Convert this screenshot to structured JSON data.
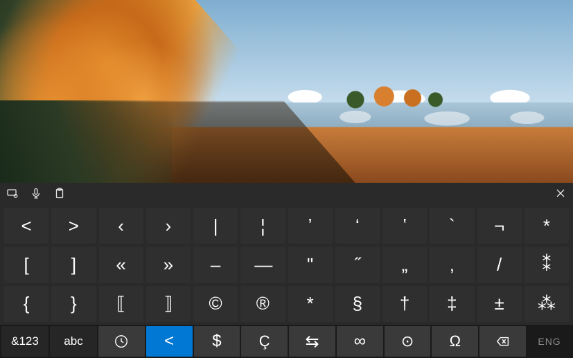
{
  "topbar": {
    "icons": [
      "keyboard-settings-icon",
      "mic-icon",
      "clipboard-icon"
    ],
    "close": "close-icon"
  },
  "rows": [
    [
      "<",
      ">",
      "‹",
      "›",
      "|",
      "¦",
      "ʼ",
      "ʻ",
      "ʽ",
      "`",
      "¬",
      "*"
    ],
    [
      "[",
      "]",
      "«",
      "»",
      "–",
      "—",
      "ʺ",
      "˝",
      "„",
      "‚",
      "/",
      "⁑"
    ],
    [
      "{",
      "}",
      "⟦",
      "⟧",
      "©",
      "®",
      "*",
      "§",
      "†",
      "‡",
      "±",
      "⁂"
    ]
  ],
  "bottom": {
    "symbols_mode": "&123",
    "letters_mode": "abc",
    "clock_tab": "clock-icon",
    "angle_tab": "<",
    "currency_tab": "$",
    "cedilla_tab": "Ç",
    "arrows_tab": "⇆",
    "infinity_tab": "∞",
    "circled_tab": "⊙",
    "omega_tab": "Ω",
    "backspace": "backspace-icon",
    "language": "ENG"
  },
  "active_tab": "angle_tab"
}
